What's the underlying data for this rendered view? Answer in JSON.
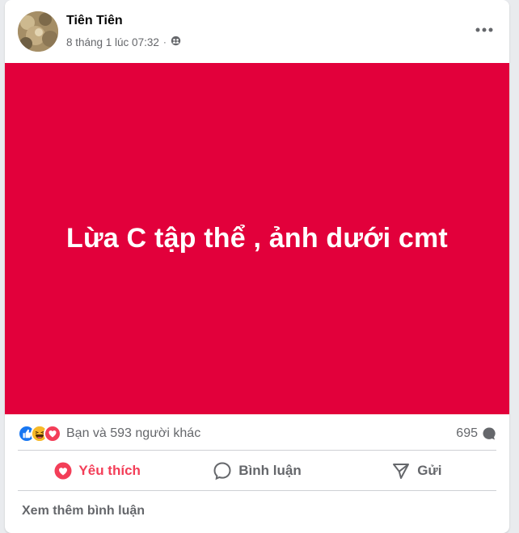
{
  "post": {
    "author": "Tiên Tiên",
    "timestamp": "8 tháng 1 lúc 07:32",
    "separator": "·",
    "audience_icon": "friends-icon",
    "banner_text": "Lừa C tập thể , ảnh dưới cmt",
    "banner_color": "#e2003b"
  },
  "stats": {
    "reaction_icons": [
      "like-icon",
      "haha-icon",
      "love-icon"
    ],
    "reactions_text": "Bạn và 593 người khác",
    "comments_count": "695"
  },
  "actions": {
    "like_label": "Yêu thích",
    "comment_label": "Bình luận",
    "share_label": "Gửi"
  },
  "comments": {
    "more_label": "Xem thêm bình luận"
  }
}
